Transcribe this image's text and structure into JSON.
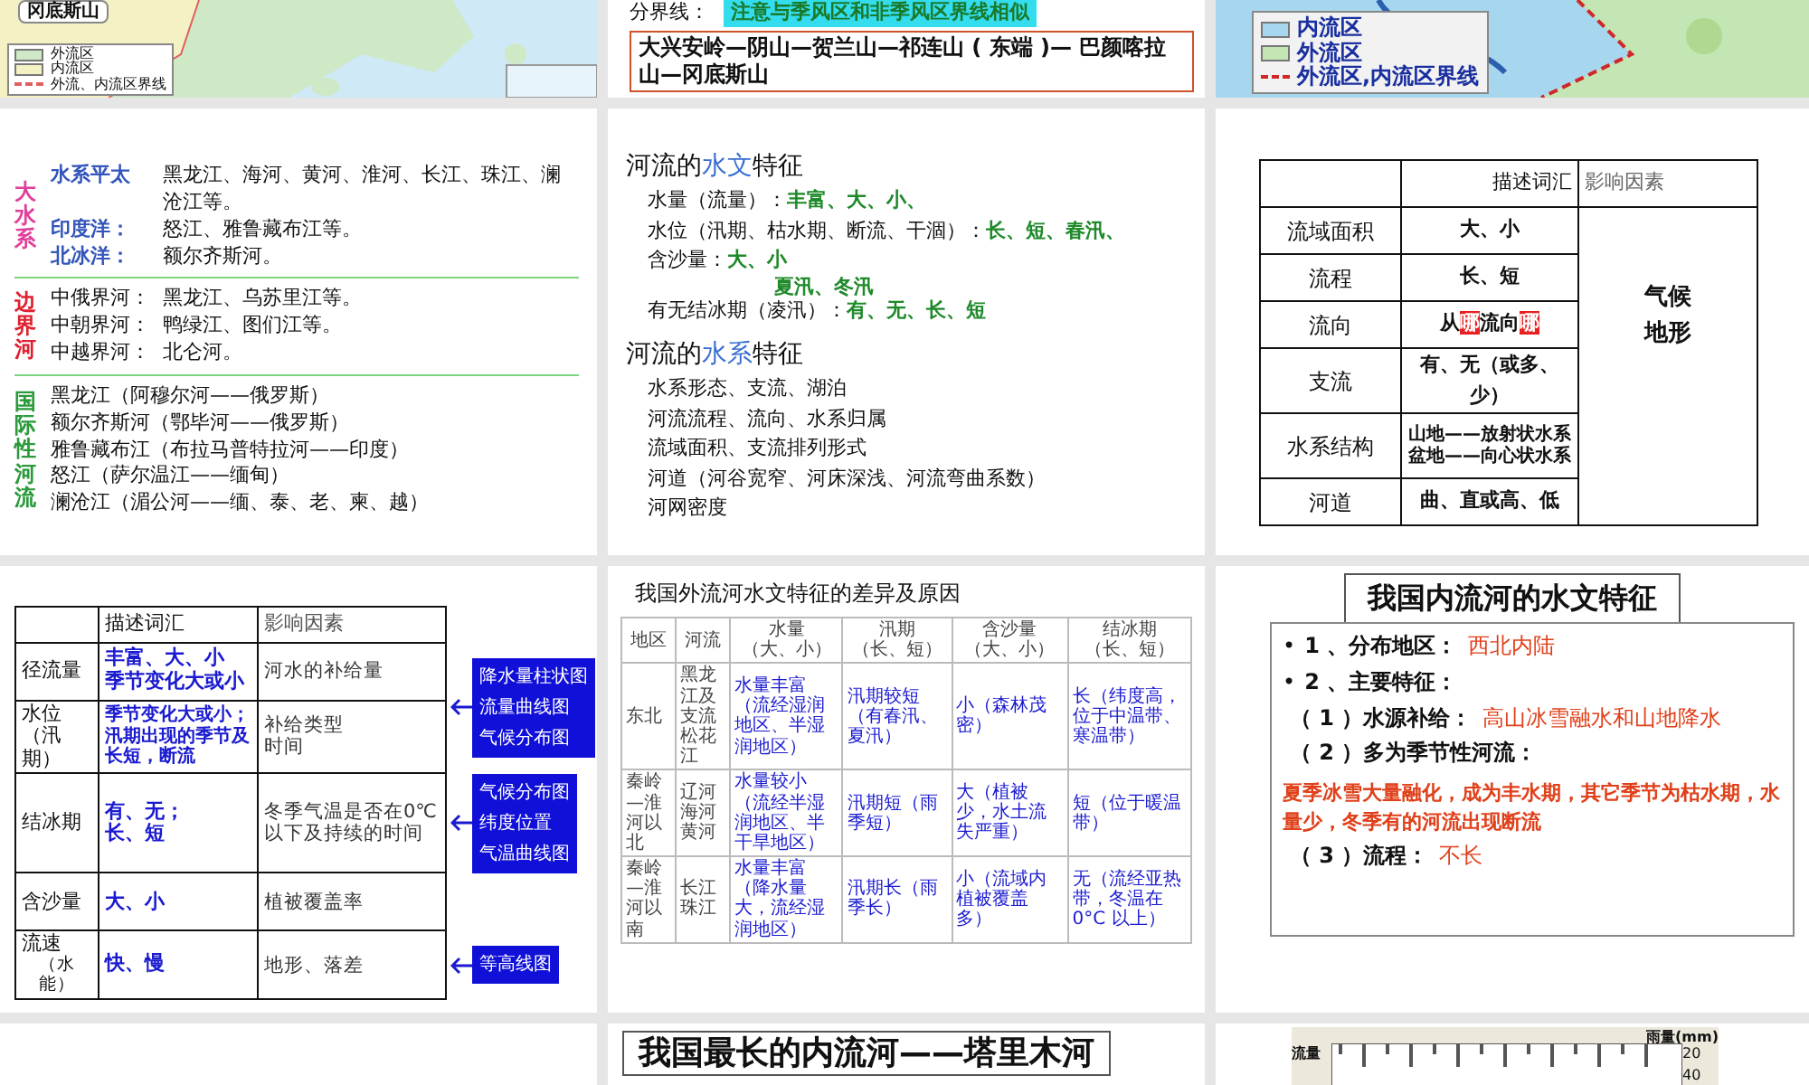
{
  "slides": [
    {
      "kind": "map_top",
      "callout": "冈底斯山",
      "legend": [
        {
          "label": "外流区",
          "kind": "area",
          "color": "#cfe8c6"
        },
        {
          "label": "内流区",
          "kind": "area",
          "color": "#f4f1c4"
        },
        {
          "label": "外流、内流区界线",
          "kind": "line",
          "color": "#e06060"
        }
      ]
    },
    {
      "kind": "boundary",
      "label": "分界线：",
      "note": "注意与季风区和非季风区界线相似",
      "boundary": "大兴安岭—阴山—贺兰山—祁连山 ( 东端 )— 巴颜喀拉山—冈底斯山"
    },
    {
      "kind": "map_legend",
      "legend": [
        {
          "label": "内流区",
          "kind": "area",
          "color": "#a6d7ee"
        },
        {
          "label": "外流区",
          "kind": "area",
          "color": "#c3e6b4"
        },
        {
          "label": "外流区,内流区界线",
          "kind": "line",
          "color": "#d02828"
        }
      ]
    },
    {
      "kind": "river_groups",
      "groups": [
        {
          "title": "大水系",
          "color": "#e0409a",
          "accented_labels": true,
          "rows": [
            {
              "label": "水系平太",
              "text": "黑龙江、海河、黄河、淮河、长江、珠江、澜沧江等。"
            },
            {
              "label": "印度洋：",
              "text": "怒江、雅鲁藏布江等。"
            },
            {
              "label": "北冰洋：",
              "text": "额尔齐斯河。"
            }
          ]
        },
        {
          "title": "边界河",
          "color": "#e02030",
          "accented_labels": false,
          "rows": [
            {
              "label": "中俄界河：",
              "text": "黑龙江、乌苏里江等。"
            },
            {
              "label": "中朝界河：",
              "text": "鸭绿江、图们江等。"
            },
            {
              "label": "中越界河：",
              "text": "北仑河。"
            }
          ]
        },
        {
          "title": "国际性河流",
          "color": "#2a9a3a",
          "rows": [
            {
              "text": "黑龙江（阿穆尔河——俄罗斯）"
            },
            {
              "text": "额尔齐斯河（鄂毕河——俄罗斯）"
            },
            {
              "text": "雅鲁藏布江（布拉马普特拉河——印度）"
            },
            {
              "text": "怒江（萨尔温江——缅甸）"
            },
            {
              "text": "澜沧江（湄公河——缅、泰、老、柬、越）"
            }
          ]
        }
      ]
    },
    {
      "kind": "features",
      "sections": [
        {
          "heading": [
            "河流的",
            "水文",
            "特征"
          ],
          "items": [
            {
              "label": "水量（流量）：",
              "value": "丰富、大、小、"
            },
            {
              "label": "水位（汛期、枯水期、断流、干涸）：",
              "value": "长、短、春汛、"
            },
            {
              "label": "含沙量：",
              "value": "大、小",
              "extra": "夏汛、冬汛"
            },
            {
              "label": "有无结冰期（凌汛）：",
              "value": "有、无、长、短"
            }
          ]
        },
        {
          "heading": [
            "河流的",
            "水系",
            "特征"
          ],
          "items": [
            {
              "label": "水系形态、支流、湖泊"
            },
            {
              "label": "河流流程、流向、水系归属"
            },
            {
              "label": "流域面积、支流排列形式"
            },
            {
              "label": "河道（河谷宽窄、河床深浅、河流弯曲系数）"
            },
            {
              "label": "河网密度"
            }
          ]
        }
      ]
    },
    {
      "kind": "term_table",
      "header": [
        "描述词汇",
        "影响因素"
      ],
      "factor": [
        "气候",
        "地形"
      ],
      "rows": [
        {
          "name": "流域面积",
          "kind": "text",
          "parts": [
            {
              "text": "大、小",
              "red": false
            }
          ]
        },
        {
          "name": "流程",
          "kind": "text",
          "parts": [
            {
              "text": "长、短",
              "red": false
            }
          ]
        },
        {
          "name": "流向",
          "kind": "text",
          "parts": [
            {
              "text": "从",
              "red": false
            },
            {
              "text": "哪",
              "red": true
            },
            {
              "text": "流向",
              "red": false
            },
            {
              "text": "哪",
              "red": true
            }
          ]
        },
        {
          "name": "支流",
          "kind": "text",
          "parts": [
            {
              "text": "有、无（或多、少）",
              "red": false
            }
          ]
        },
        {
          "name": "水系结构",
          "kind": "lines",
          "lines": [
            "山地——放射状水系",
            "盆地——向心状水系"
          ]
        },
        {
          "name": "河道",
          "kind": "text",
          "parts": [
            {
              "text": "曲、直或高、低",
              "red": false
            }
          ]
        }
      ]
    },
    {
      "kind": "factor_table",
      "header": [
        "描述词汇",
        "影响因素"
      ],
      "rows": [
        {
          "name": "径流量",
          "desc": [
            "丰富、大、小",
            "季节变化大或小"
          ],
          "factor": [
            "河水的补给量"
          ],
          "callout": [
            "降水量柱状图",
            "流量曲线图",
            "气候分布图"
          ]
        },
        {
          "name": "水位（汛期）",
          "desc": [
            "季节变化大或小；汛期出现的季节及长短，断流"
          ],
          "factor": [
            "补给类型",
            "时间"
          ]
        },
        {
          "name": "结冰期",
          "desc": [
            "有、无；",
            "长、短"
          ],
          "factor": [
            "冬季气温是否在0℃以下及持续的时间"
          ],
          "callout": [
            "气候分布图",
            "纬度位置",
            "气温曲线图"
          ]
        },
        {
          "name": "含沙量",
          "desc": [
            "大、小"
          ],
          "factor": [
            "植被覆盖率"
          ]
        },
        {
          "name": "流速",
          "note": "（水能）",
          "desc": [
            "快、慢"
          ],
          "factor": [
            "地形、落差"
          ],
          "callout": [
            "等高线图"
          ]
        }
      ]
    },
    {
      "kind": "region_table",
      "title": "我国外流河水文特征的差异及原因",
      "header": [
        {
          "title": "地区"
        },
        {
          "title": "河流"
        },
        {
          "title": "水量",
          "sub": "（大、小）"
        },
        {
          "title": "汛期",
          "sub": "（长、短）"
        },
        {
          "title": "含沙量",
          "sub": "（大、小）"
        },
        {
          "title": "结冰期",
          "sub": "（长、短）"
        }
      ],
      "rows": [
        [
          "东北",
          "黑龙江及支流松花江",
          "水量丰富（流经湿润地区、半湿润地区）",
          "汛期较短（有春汛、夏汛）",
          "小（森林茂密）",
          "长（纬度高，位于中温带、寒温带）"
        ],
        [
          "秦岭—淮河以北",
          "辽河海河黄河",
          "水量较小（流经半湿润地区、半干旱地区）",
          "汛期短（雨季短）",
          "大（植被少，水土流失严重）",
          "短（位于暖温带）"
        ],
        [
          "秦岭—淮河以南",
          "长江珠江",
          "水量丰富（降水量大，流经湿润地区）",
          "汛期长（雨季长）",
          "小（流域内植被覆盖多）",
          "无（流经亚热带，冬温在 0°C 以上）"
        ]
      ]
    },
    {
      "kind": "inland",
      "title": "我国内流河的水文特征",
      "lines": [
        {
          "kind": "bullet",
          "marker": "•",
          "label": "1 、分布地区：",
          "value": "西北内陆"
        },
        {
          "kind": "bullet",
          "marker": "•",
          "label": "2 、主要特征："
        },
        {
          "kind": "line",
          "label": "（ 1 ）水源补给：",
          "value": "高山冰雪融水和山地降水"
        },
        {
          "kind": "line",
          "label": "（ 2 ）多为季节性河流："
        },
        {
          "kind": "paragraph",
          "value": "夏季冰雪大量融化，成为丰水期，其它季节为枯水期，水量少，冬季有的河流出现断流"
        },
        {
          "kind": "line",
          "label": "（ 3 ）流程：",
          "value": "不长"
        }
      ]
    },
    {
      "kind": "blank"
    },
    {
      "kind": "title_photos",
      "title": "我国最长的内流河——塔里木河"
    },
    {
      "kind": "chart_image",
      "top_label": "雨量(mm)",
      "left_label": "流量",
      "ticks": [
        "20",
        "40"
      ]
    }
  ]
}
